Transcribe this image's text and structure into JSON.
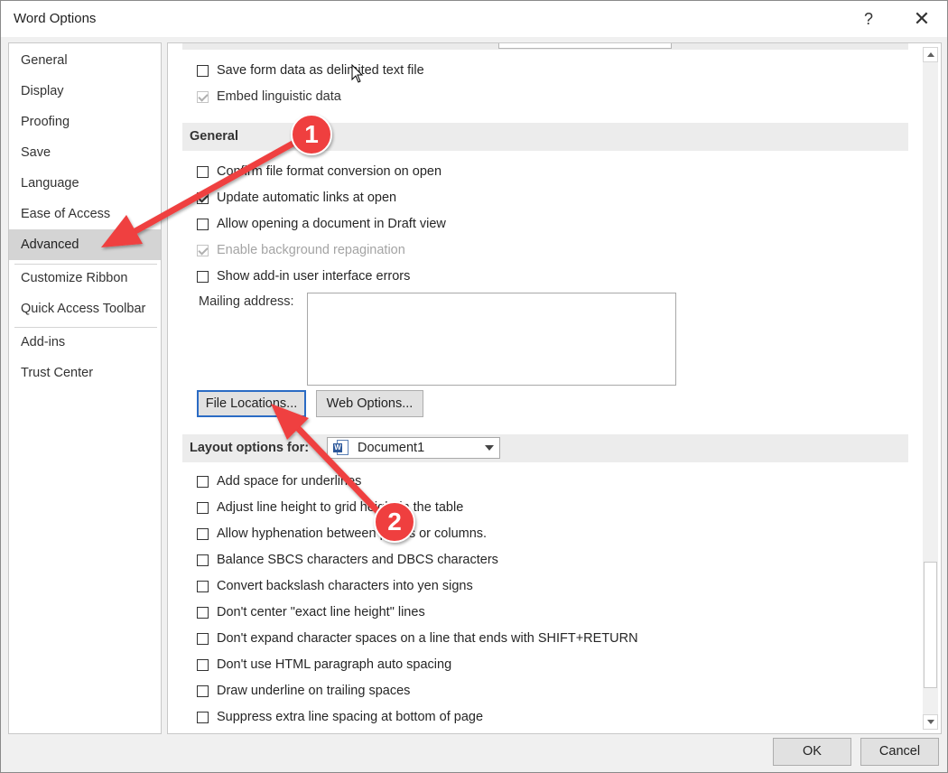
{
  "window": {
    "title": "Word Options",
    "help_symbol": "?",
    "close_symbol": "✕"
  },
  "nav": {
    "items": [
      {
        "label": "General"
      },
      {
        "label": "Display"
      },
      {
        "label": "Proofing"
      },
      {
        "label": "Save"
      },
      {
        "label": "Language"
      },
      {
        "label": "Ease of Access"
      },
      {
        "label": "Advanced",
        "selected": true
      },
      {
        "label": "Customize Ribbon"
      },
      {
        "label": "Quick Access Toolbar"
      },
      {
        "label": "Add-ins"
      },
      {
        "label": "Trust Center"
      }
    ]
  },
  "save_options": {
    "save_form_data": {
      "label": "Save form data as delimited text file",
      "checked": false
    },
    "embed_linguistic": {
      "label": "Embed linguistic data",
      "checked": true,
      "disabled": true
    }
  },
  "general": {
    "header": "General",
    "options": {
      "confirm_conversion": {
        "label": "Confirm file format conversion on open",
        "checked": false
      },
      "update_links": {
        "label": "Update automatic links at open",
        "checked": true
      },
      "draft_view": {
        "label": "Allow opening a document in Draft view",
        "checked": false
      },
      "background_repagination": {
        "label": "Enable background repagination",
        "checked": true,
        "disabled": true
      },
      "addin_errors": {
        "label": "Show add-in user interface errors",
        "checked": false
      }
    },
    "mailing_address_label": "Mailing address:",
    "mailing_address_value": "",
    "file_locations_button": "File Locations...",
    "web_options_button": "Web Options..."
  },
  "layout": {
    "header": "Layout options for:",
    "document_select": "Document1",
    "options": {
      "underlines_space": {
        "label": "Add space for underlines",
        "checked": false
      },
      "line_height_grid": {
        "label": "Adjust line height to grid height in the table",
        "checked": false
      },
      "hyphenation": {
        "label": "Allow hyphenation between pages or columns.",
        "checked": false
      },
      "balance_sbcs": {
        "label": "Balance SBCS characters and DBCS characters",
        "checked": false
      },
      "backslash_yen": {
        "label": "Convert backslash characters into yen signs",
        "checked": false
      },
      "dont_center": {
        "label": "Don't center \"exact line height\" lines",
        "checked": false
      },
      "dont_expand": {
        "label": "Don't expand character spaces on a line that ends with SHIFT+RETURN",
        "checked": false
      },
      "html_spacing": {
        "label": "Don't use HTML paragraph auto spacing",
        "checked": false
      },
      "underline_trailing": {
        "label": "Draw underline on trailing spaces",
        "checked": false
      },
      "suppress_spacing": {
        "label": "Suppress extra line spacing at bottom of page",
        "checked": false
      }
    }
  },
  "footer": {
    "ok": "OK",
    "cancel": "Cancel"
  },
  "annotations": {
    "badge_1": "1",
    "badge_2": "2",
    "color": "#ef3f3f"
  }
}
